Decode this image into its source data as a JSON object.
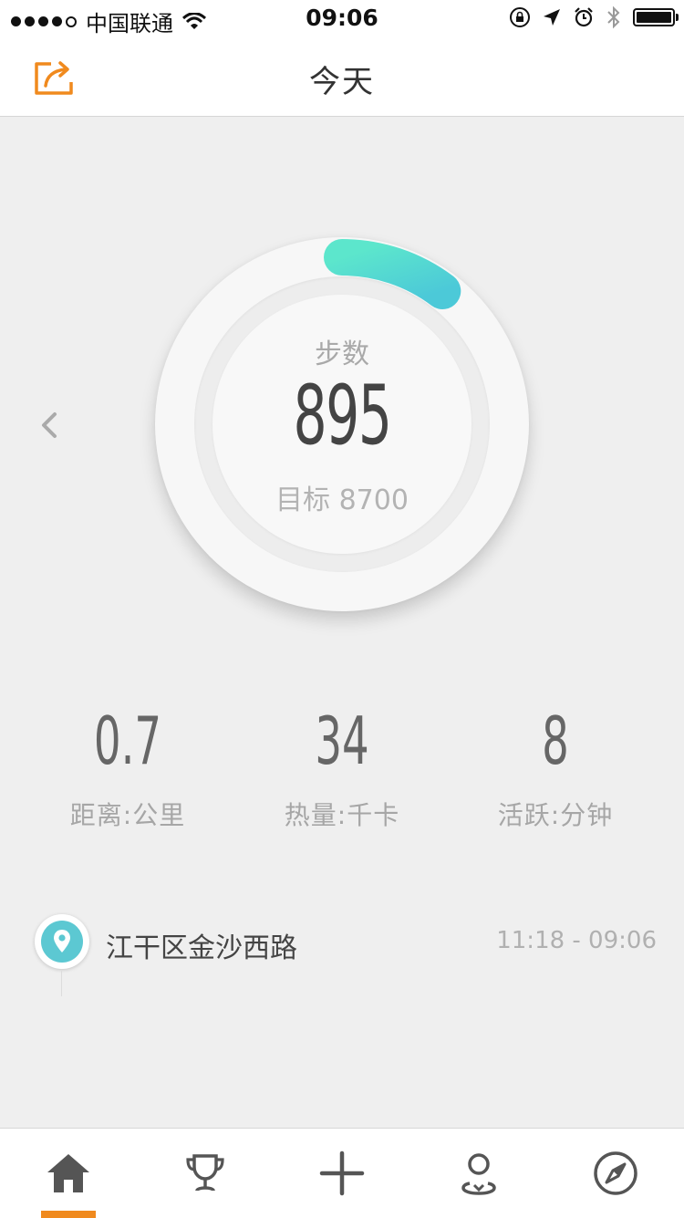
{
  "status_bar": {
    "carrier": "中国联通",
    "time": "09:06"
  },
  "nav": {
    "title": "今天"
  },
  "ring": {
    "label": "步数",
    "steps": "895",
    "goal_text": "目标 8700",
    "progress_fraction": 0.103,
    "gradient_start": "#5ce6cc",
    "gradient_end": "#4cc9d8"
  },
  "stats": [
    {
      "value": "0.7",
      "label": "距离:公里"
    },
    {
      "value": "34",
      "label": "热量:千卡"
    },
    {
      "value": "8",
      "label": "活跃:分钟"
    }
  ],
  "location": {
    "name": "江干区金沙西路",
    "time_range": "11:18 - 09:06",
    "pin_color": "#5cc8d2"
  },
  "tabs": [
    {
      "icon": "home-icon",
      "active": true
    },
    {
      "icon": "trophy-icon",
      "active": false
    },
    {
      "icon": "plus-icon",
      "active": false
    },
    {
      "icon": "profile-icon",
      "active": false
    },
    {
      "icon": "compass-icon",
      "active": false
    }
  ],
  "colors": {
    "accent": "#f08a1e",
    "background": "#efefef"
  }
}
